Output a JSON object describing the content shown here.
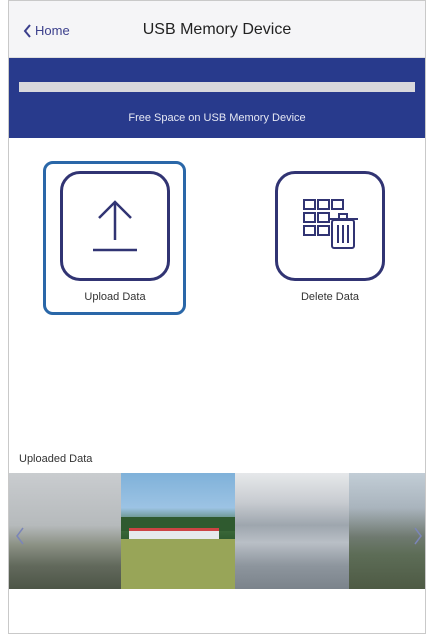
{
  "navbar": {
    "back_label": "Home",
    "title": "USB Memory Device"
  },
  "storage": {
    "free_space_label": "Free Space on USB Memory Device",
    "used_fraction": 1.0
  },
  "actions": {
    "upload_label": "Upload Data",
    "delete_label": "Delete Data"
  },
  "uploaded": {
    "title": "Uploaded Data"
  },
  "colors": {
    "accent": "#283a8c",
    "icon_stroke": "#313473",
    "selection": "#2a67a8"
  },
  "icons": {
    "back": "chevron-left-icon",
    "upload": "upload-icon",
    "delete": "grid-trash-icon",
    "prev": "chevron-left-icon",
    "next": "chevron-right-icon"
  }
}
